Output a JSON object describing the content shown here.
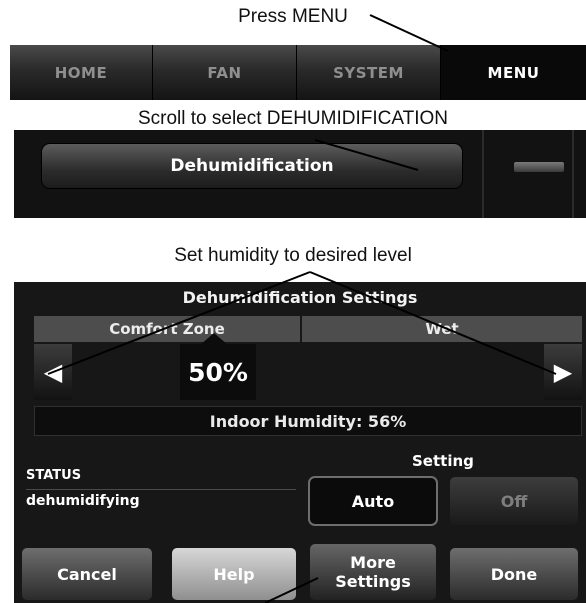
{
  "captions": {
    "step1": "Press MENU",
    "step2": "Scroll to select DEHUMIDIFICATION",
    "step3": "Set humidity to desired level"
  },
  "menu": {
    "tabs": [
      "HOME",
      "FAN",
      "SYSTEM",
      "MENU"
    ],
    "active": "MENU"
  },
  "list": {
    "item_label": "Dehumidification"
  },
  "settings": {
    "title": "Dehumidification Settings",
    "left_label": "Comfort Zone",
    "right_label": "Wet",
    "value": "50%",
    "left_arrow": "◀",
    "right_arrow": "▶",
    "indoor_humidity": "Indoor Humidity: 56%",
    "status_label": "STATUS",
    "status_value": "dehumidifying",
    "setting_label": "Setting",
    "auto_label": "Auto",
    "off_label": "Off",
    "cancel_label": "Cancel",
    "help_label": "Help",
    "more_label": "More\nSettings",
    "done_label": "Done"
  },
  "colors": {
    "panel_bg": "#171717",
    "label_bg": "#4d4d4d",
    "text": "#ffffff"
  }
}
